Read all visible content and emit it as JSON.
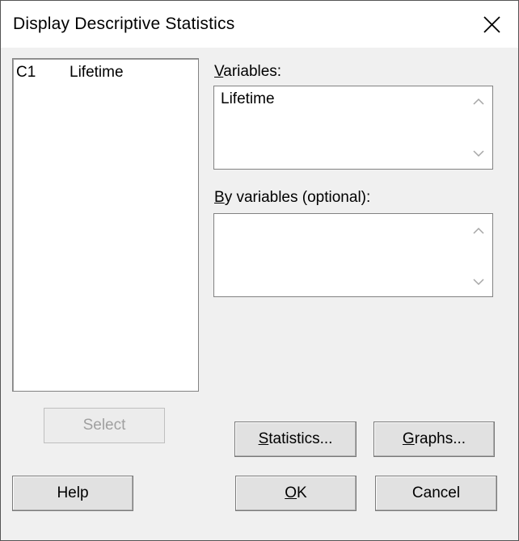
{
  "window": {
    "title": "Display Descriptive Statistics",
    "close_icon": "close-icon"
  },
  "variable_list": {
    "items": [
      {
        "column": "C1",
        "name": "Lifetime"
      }
    ]
  },
  "variables_field": {
    "label_mnemonic": "V",
    "label_rest": "ariables:",
    "value": "Lifetime"
  },
  "by_variables_field": {
    "label_mnemonic": "B",
    "label_rest": "y variables (optional):",
    "value": ""
  },
  "buttons": {
    "select": "Select",
    "statistics_mnemonic": "S",
    "statistics_rest": "tatistics...",
    "graphs_mnemonic": "G",
    "graphs_rest": "raphs...",
    "help": "Help",
    "ok_mnemonic": "O",
    "ok_rest": "K",
    "cancel": "Cancel"
  }
}
